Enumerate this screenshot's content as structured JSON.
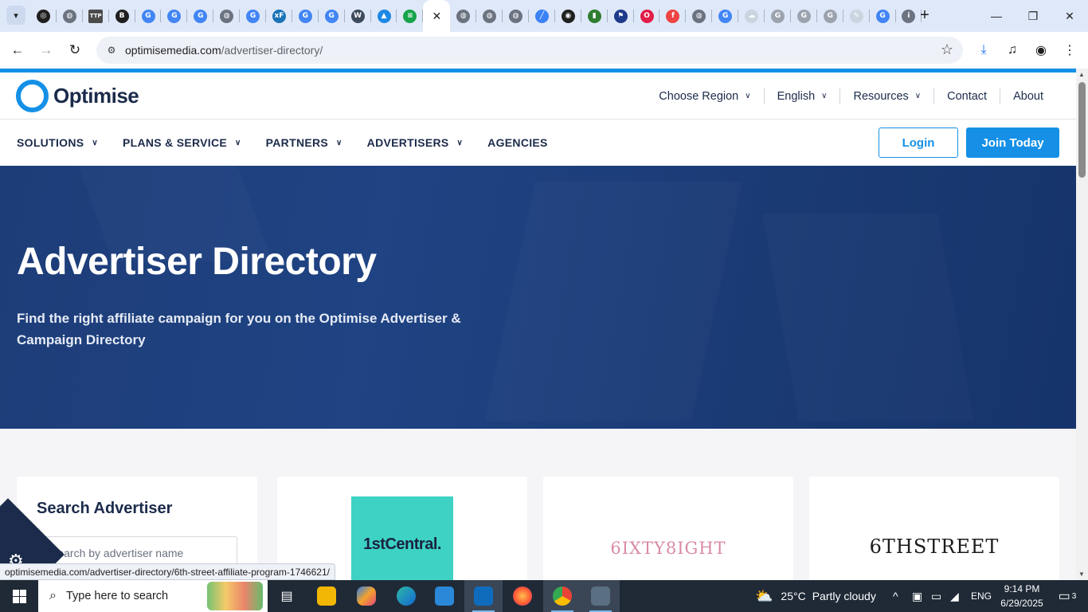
{
  "browser": {
    "tabs": [
      {
        "icon": "openai-icon",
        "color": "#1f1f1f",
        "glyph": "◎"
      },
      {
        "icon": "globe-icon",
        "color": "#6b7280",
        "glyph": "◍"
      },
      {
        "icon": "ttp-icon",
        "color": "#4b4b4b",
        "glyph": "TTP"
      },
      {
        "icon": "b-icon",
        "color": "#1f1f1f",
        "glyph": "B"
      },
      {
        "icon": "google-icon",
        "color": "#4285f4",
        "glyph": "G"
      },
      {
        "icon": "google-icon",
        "color": "#4285f4",
        "glyph": "G"
      },
      {
        "icon": "google-icon",
        "color": "#4285f4",
        "glyph": "G"
      },
      {
        "icon": "globe-icon",
        "color": "#6b7280",
        "glyph": "◍"
      },
      {
        "icon": "google-icon",
        "color": "#4285f4",
        "glyph": "G"
      },
      {
        "icon": "xf-icon",
        "color": "#1a73b8",
        "glyph": "xF"
      },
      {
        "icon": "google-icon",
        "color": "#4285f4",
        "glyph": "G"
      },
      {
        "icon": "google-icon",
        "color": "#4285f4",
        "glyph": "G"
      },
      {
        "icon": "wordpress-icon",
        "color": "#3c4a5c",
        "glyph": "W"
      },
      {
        "icon": "cap-icon",
        "color": "#1e88e5",
        "glyph": "▲"
      },
      {
        "icon": "green-circle-icon",
        "color": "#16a34a",
        "glyph": "≡"
      },
      {
        "icon": "close-icon",
        "color": "#ffffff",
        "glyph": "✕",
        "active": true
      },
      {
        "icon": "globe-icon",
        "color": "#6b7280",
        "glyph": "◍"
      },
      {
        "icon": "globe-icon",
        "color": "#6b7280",
        "glyph": "◍"
      },
      {
        "icon": "globe-icon",
        "color": "#6b7280",
        "glyph": "◍"
      },
      {
        "icon": "chart-icon",
        "color": "#3b82f6",
        "glyph": "╱"
      },
      {
        "icon": "camera-icon",
        "color": "#1f1f1f",
        "glyph": "◉"
      },
      {
        "icon": "bars-icon",
        "color": "#2e7d32",
        "glyph": "▮"
      },
      {
        "icon": "flag-icon",
        "color": "#1e3a8a",
        "glyph": "⚑"
      },
      {
        "icon": "opera-icon",
        "color": "#e11d48",
        "glyph": "O"
      },
      {
        "icon": "f-icon",
        "color": "#ef4444",
        "glyph": "f"
      },
      {
        "icon": "globe-icon",
        "color": "#6b7280",
        "glyph": "◍"
      },
      {
        "icon": "google-icon",
        "color": "#4285f4",
        "glyph": "G"
      },
      {
        "icon": "cloud-icon",
        "color": "#cbd5e1",
        "glyph": "☁"
      },
      {
        "icon": "google-icon",
        "color": "#9ca3af",
        "glyph": "G"
      },
      {
        "icon": "google-icon",
        "color": "#9ca3af",
        "glyph": "G"
      },
      {
        "icon": "google-icon",
        "color": "#9ca3af",
        "glyph": "G"
      },
      {
        "icon": "pen-icon",
        "color": "#cbd5e1",
        "glyph": "✎"
      },
      {
        "icon": "google-icon",
        "color": "#4285f4",
        "glyph": "G"
      },
      {
        "icon": "info-icon",
        "color": "#6b7280",
        "glyph": "i"
      }
    ],
    "url_host": "optimisemedia.com",
    "url_path": "/advertiser-directory/",
    "status_url": "optimisemedia.com/advertiser-directory/6th-street-affiliate-program-1746621/"
  },
  "site": {
    "brand": "Optimise",
    "topnav": [
      {
        "label": "Choose Region",
        "dropdown": true
      },
      {
        "label": "English",
        "dropdown": true
      },
      {
        "label": "Resources",
        "dropdown": true
      },
      {
        "label": "Contact",
        "dropdown": false
      },
      {
        "label": "About",
        "dropdown": false
      }
    ],
    "mainnav": [
      {
        "label": "SOLUTIONS",
        "dropdown": true
      },
      {
        "label": "PLANS & SERVICE",
        "dropdown": true
      },
      {
        "label": "PARTNERS",
        "dropdown": true
      },
      {
        "label": "ADVERTISERS",
        "dropdown": true
      },
      {
        "label": "AGENCIES",
        "dropdown": false
      }
    ],
    "login_label": "Login",
    "join_label": "Join Today",
    "accent": "#1590e6",
    "hero": {
      "title": "Advertiser Directory",
      "subtitle": "Find the right affiliate campaign for you on the Optimise Advertiser & Campaign Directory"
    },
    "search": {
      "title": "Search Advertiser",
      "placeholder": "Search by advertiser name"
    },
    "advertisers": [
      {
        "name": "1stCentral.",
        "style": "1st"
      },
      {
        "name": "6IXTY8IGHT",
        "style": "68"
      },
      {
        "name": "6THSTREET",
        "style": "6th"
      }
    ]
  },
  "taskbar": {
    "search_placeholder": "Type here to search",
    "weather_temp": "25°C",
    "weather_text": "Partly cloudy",
    "weather_badge": "1",
    "language": "ENG",
    "time": "9:14 PM",
    "date": "6/29/2025",
    "notifications": "3"
  }
}
